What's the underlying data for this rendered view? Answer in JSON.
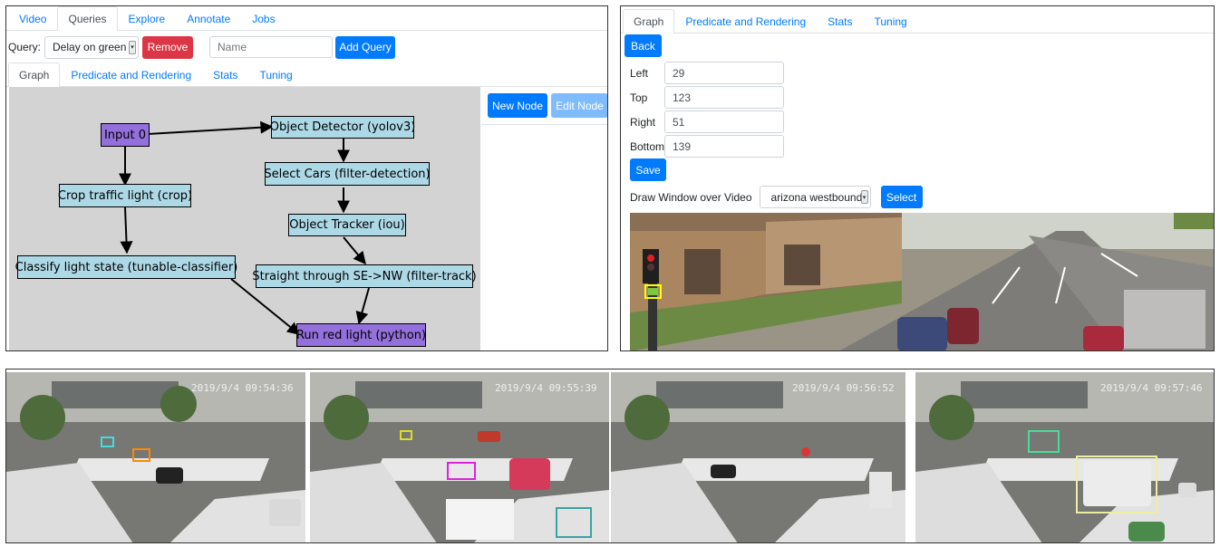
{
  "left": {
    "main_tabs": [
      "Video",
      "Queries",
      "Explore",
      "Annotate",
      "Jobs"
    ],
    "query_label": "Query:",
    "query_select": "Delay on green",
    "remove_label": "Remove",
    "name_placeholder": "Name",
    "add_query_label": "Add Query",
    "sub_tabs": [
      "Graph",
      "Predicate and Rendering",
      "Stats",
      "Tuning"
    ],
    "new_node_label": "New Node",
    "edit_node_label": "Edit Node",
    "nodes": {
      "input0": "Input 0",
      "object_detector": "Object Detector (yolov3)",
      "select_cars": "Select Cars (filter-detection)",
      "object_tracker": "Object Tracker (iou)",
      "crop_light": "Crop traffic light (crop)",
      "classify_light": "Classify light state (tunable-classifier)",
      "straight_through": "Straight through SE->NW (filter-track)",
      "run_red": "Run red light (python)"
    }
  },
  "right": {
    "tabs": [
      "Graph",
      "Predicate and Rendering",
      "Stats",
      "Tuning"
    ],
    "back_label": "Back",
    "fields": [
      {
        "label": "Left",
        "value": "29"
      },
      {
        "label": "Top",
        "value": "123"
      },
      {
        "label": "Right",
        "value": "51"
      },
      {
        "label": "Bottom",
        "value": "139"
      }
    ],
    "save_label": "Save",
    "draw_window_label": "Draw Window over Video",
    "video_select": "arizona westbound",
    "select_label": "Select"
  },
  "bottom": {
    "timestamps": [
      "2019/9/4 09:54:36",
      "2019/9/4 09:55:39",
      "2019/9/4 09:56:52",
      "2019/9/4 09:57:46"
    ]
  },
  "colors": {
    "primary": "#007bff",
    "danger": "#dc3545",
    "node_blue": "#add8e6",
    "node_purple": "#9370db",
    "graph_bg": "#d3d3d3"
  }
}
